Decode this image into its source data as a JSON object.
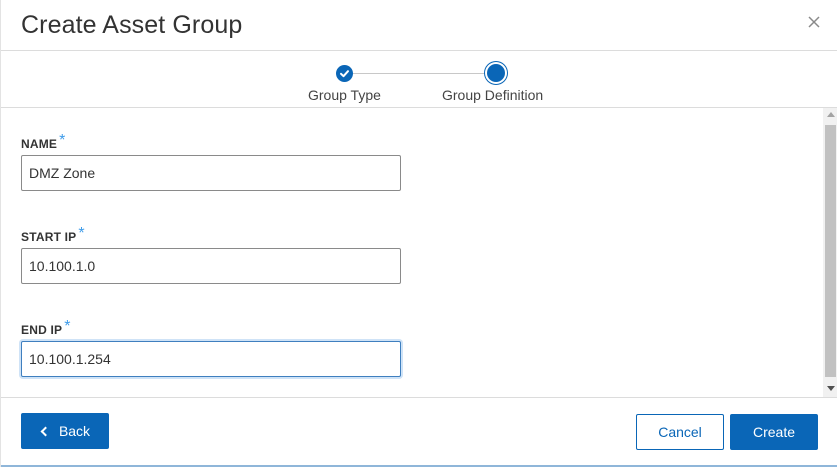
{
  "dialog": {
    "title": "Create Asset Group",
    "close_icon": "close-icon"
  },
  "stepper": {
    "steps": [
      {
        "label": "Group Type",
        "state": "completed",
        "icon": "check-icon"
      },
      {
        "label": "Group Definition",
        "state": "active"
      }
    ]
  },
  "form": {
    "required_marker": "*",
    "fields": [
      {
        "label": "NAME",
        "value": "DMZ Zone"
      },
      {
        "label": "START IP",
        "value": "10.100.1.0"
      },
      {
        "label": "END IP",
        "value": "10.100.1.254",
        "focused": true
      }
    ]
  },
  "footer": {
    "back_label": "Back",
    "cancel_label": "Cancel",
    "create_label": "Create"
  },
  "colors": {
    "primary": "#0a66b7",
    "required": "#3d9be9",
    "focus_ring": "#cfe3f7"
  }
}
